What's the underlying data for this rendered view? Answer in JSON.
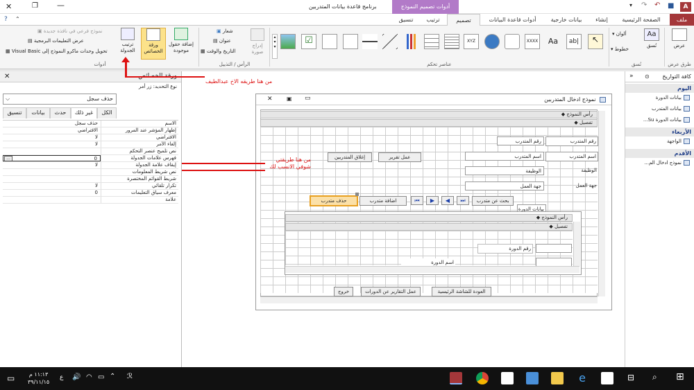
{
  "window": {
    "title": "برنامج قاعدة بيانات المتدربين",
    "context_tab_group": "أدوات تصميم النموذج",
    "quick_access_user": "A"
  },
  "ribbon_tabs": [
    {
      "label": "ملف",
      "x": 0
    },
    {
      "label": "الصفحة الرئيسية",
      "x": 0
    },
    {
      "label": "إنشاء",
      "x": 0
    },
    {
      "label": "بيانات خارجية",
      "x": 0
    },
    {
      "label": "أدوات قاعدة البيانات",
      "x": 0
    },
    {
      "label": "تصميم",
      "x": 0
    },
    {
      "label": "ترتيب",
      "x": 0
    },
    {
      "label": "تنسيق",
      "x": 0
    }
  ],
  "ribbon": {
    "groups": {
      "views": "طرق عرض",
      "themes": "نُسق",
      "controls": "عناصر تحكم",
      "header_footer": "الرأس / التذييل",
      "tools": "أدوات"
    },
    "view_btn": "عرض",
    "themes_btn": "نُسق",
    "colors_btn": "ألوان",
    "fonts_btn": "خطوط",
    "insert_image": "إدراج صورة",
    "logo": "شعار",
    "title": "عنوان",
    "date_time": "التاريخ والوقت",
    "add_existing_fields": "إضافة حقول موجودة",
    "property_sheet": "ورقة الخصائص",
    "tab_order": "ترتيب الجدولة",
    "subform_new_window": "نموذج فرعي في نافذة جديدة",
    "view_code": "عرض التعليمات البرمجية",
    "convert_macros": "تحويل وحدات ماكرو النموذج إلى Visual Basic"
  },
  "property_sheet": {
    "title": "ورقة الخصائص",
    "selection_type": "نوع التحديد: زر أمر",
    "selected_control": "حذف سجل",
    "tabs": [
      "تنسيق",
      "بيانات",
      "حدث",
      "غير ذلك",
      "الكل"
    ],
    "active_tab": "غير ذلك",
    "rows": [
      {
        "name": "الاسم",
        "value": "حذف سجل"
      },
      {
        "name": "إظهار المؤشر عند المرور",
        "value": "الافتراضي"
      },
      {
        "name": "الافتراضي",
        "value": "لا"
      },
      {
        "name": "إلغاء الأمر",
        "value": "لا"
      },
      {
        "name": "نص تلميح عنصر التحكم",
        "value": ""
      },
      {
        "name": "فهرس علامات الجدولة",
        "value": "0"
      },
      {
        "name": "إيقاف علامة الجدولة",
        "value": "لا"
      },
      {
        "name": "نص شريط المعلومات",
        "value": ""
      },
      {
        "name": "شريط القوائم المختصرة",
        "value": ""
      },
      {
        "name": "تكرار تلقائي",
        "value": "لا"
      },
      {
        "name": "معرف سياق التعليمات",
        "value": "0"
      },
      {
        "name": "علامة",
        "value": ""
      }
    ]
  },
  "form": {
    "title": "نموذج ادخال المتدربين",
    "header_section": "رأس النموذج",
    "detail_section": "تفصيل",
    "labels": {
      "trainee_no": "رقم المتدرب",
      "trainee_name": "اسم المتدرب",
      "job": "الوظيفة",
      "workplace": "جهة العمل",
      "course_data": "بيانات الدورة"
    },
    "textboxes": {
      "trainee_no": "رقم المتدرب",
      "trainee_name": "اسم المتدرب",
      "job": "الوظيفة",
      "workplace": "جهة العمل"
    },
    "buttons": {
      "close_trainees": "إغلاق المتدربين",
      "make_report": "عمل تقرير",
      "search_trainee": "بحث عن متدرب",
      "add_trainee": "اضافة متدرب",
      "delete_trainee": "حذف متدرب",
      "exit": "خروج",
      "courses_reports": "عمل التقارير عن الدورات",
      "back_main": "العودة للشاشة الرئيسية"
    },
    "nav": {
      "first": "⏮",
      "prev": "◀",
      "next": "▶",
      "last": "⏭"
    },
    "subform": {
      "header_section": "رأس النموذج",
      "detail_section": "تفصيل",
      "course_no_label": "رقم الدورة",
      "course_name_label": "اسم الدورة"
    }
  },
  "annotations": {
    "top": "من هنا طريقه الاخ عبدالطيف",
    "middle": "من هنا طريقتي شوفي الانسب لك"
  },
  "nav_pane": {
    "title": "كافة التواريخ",
    "groups": [
      {
        "label": "اليوم",
        "items": [
          "بيانات الدورة",
          "بيانات المتدرب",
          "بيانات الدورة Su..."
        ]
      },
      {
        "label": "الأربعاء",
        "items": [
          "الواجهة"
        ]
      },
      {
        "label": "الأقدم",
        "items": [
          "نموذج ادخال الم..."
        ]
      }
    ]
  },
  "taskbar": {
    "time": "١١:١٣ م",
    "date": "٣٩/١١/١٥",
    "lang": "ع"
  },
  "colors": {
    "file_tab": "#a4373a",
    "context_tab": "#b27ac8",
    "annotation": "#dd1111",
    "selected_button": "#fbe0a8"
  }
}
